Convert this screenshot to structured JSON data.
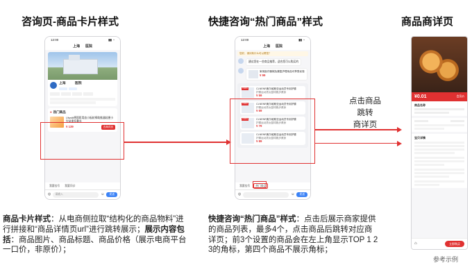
{
  "titles": {
    "left": "咨询页-商品卡片样式",
    "middle": "快捷咨询“热门商品”样式",
    "right": "商品商详页"
  },
  "left_phone": {
    "time": "12:00",
    "header_a": "上海",
    "header_b": "医院",
    "store_title": "上海",
    "store_sub": "医院",
    "tags": [
      "",
      "",
      "",
      ""
    ],
    "hot_label": "热门商品",
    "product_title": "Ulwolk德国医用血小板轮椅助推器轻便小型承重折叠车",
    "product_price": "¥ 139",
    "buy_label": "去商详页",
    "tab_1": "我要挂号",
    "tab_2": "我要问诊",
    "input_placeholder": "请输入",
    "send_label": "发送"
  },
  "middle_phone": {
    "time": "12:00",
    "header_a": "上海",
    "header_b": "医院",
    "notice": "您好，请问有什么可以帮您？",
    "msg_1": "建议您在一些商品推荐，适合您可以购买的",
    "msg_2": "家用医疗器械及康复护理用品可享受优惠",
    "msg_2_price": "¥ 99",
    "products": [
      {
        "top": "TOP1",
        "title": "CLNENR奥尔维斯亚运动员专用护膝",
        "title2": "护膝运动男女篮球跑步健身",
        "price": "¥ 59"
      },
      {
        "top": "TOP2",
        "title": "CLNENR奥尔维斯亚运动员专用护膝",
        "title2": "护膝运动男女篮球跑步健身",
        "price": "¥ 69"
      },
      {
        "top": "TOP3",
        "title": "CLNENR奥尔维斯亚运动员专用护膝",
        "title2": "护膝运动男女篮球跑步健身",
        "price": "¥ 79"
      },
      {
        "top": "",
        "title": "CLNENR奥尔维斯亚运动员专用护膝",
        "title2": "护膝运动男女篮球跑步健身",
        "price": "¥ 89"
      }
    ],
    "tab_1": "我要挂号",
    "tab_2": "热门商品",
    "send_label": "发送"
  },
  "right_phone": {
    "price": "¥0.01",
    "price_tag": "会员价",
    "shop_name": "商品名称",
    "section_label": "宝贝详情",
    "cta": "立即购买"
  },
  "annotation": {
    "line1": "点击商品",
    "line2": "跳转",
    "line3": "商详页"
  },
  "desc_left": {
    "bold1": "商品卡片样式",
    "text1": "：从电商侧拉取“结构化的商品物料”进行拼接和“商品详情页url”进行跳转展示；",
    "bold2": "展示内容包括",
    "text2": "：商品图片、商品标题、商品价格（展示电商平台一口价，非原价）；"
  },
  "desc_middle": {
    "bold1": "快捷咨询“热门商品”样式",
    "text1": "：点击后展示商家提供的商品列表，最多4个，点击商品后跳转对应商详页；前3个设置的商品会在左上角显示TOP 1 2 3的角标，第四个商品不展示角标；"
  },
  "footnote": "参考示例",
  "colors": {
    "accent_red": "#e03131",
    "brand_blue": "#3b82f6"
  }
}
